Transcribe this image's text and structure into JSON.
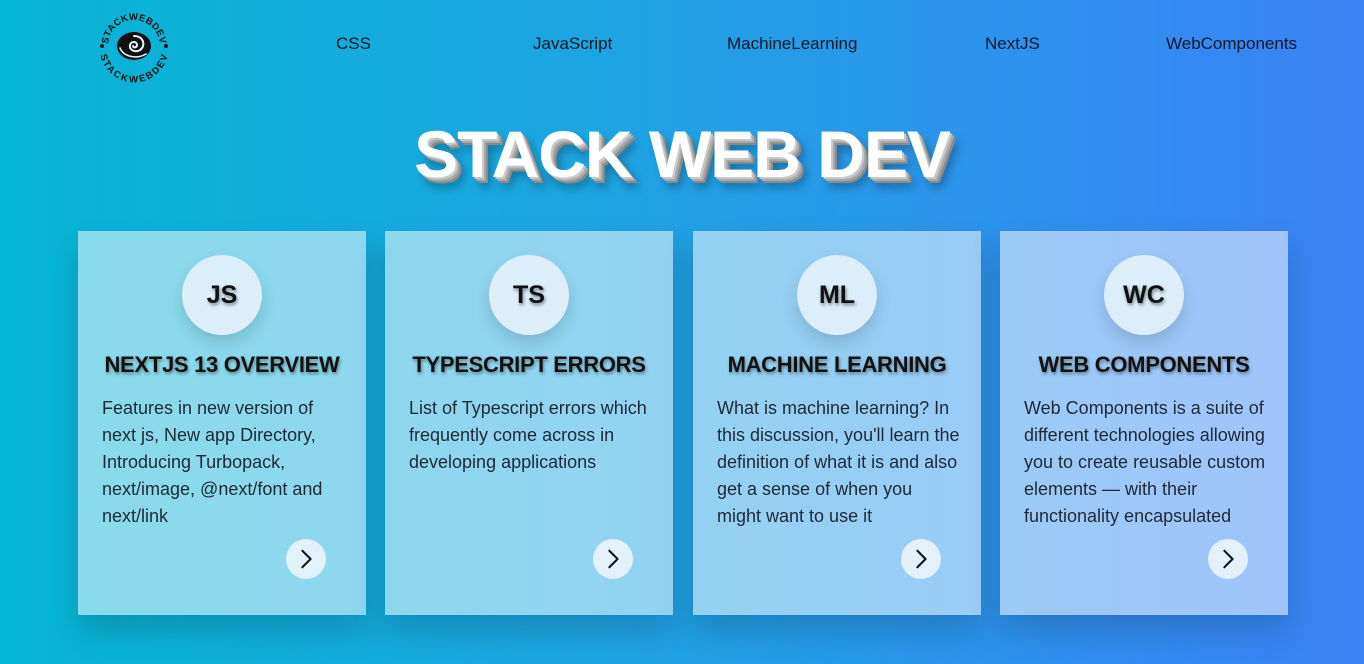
{
  "logo": {
    "text_top": "STACKWEBDEV",
    "text_bottom": "STACKWEBDEV",
    "icon": "spiral-logo-icon"
  },
  "nav": {
    "links": [
      {
        "label": "CSS"
      },
      {
        "label": "JavaScript"
      },
      {
        "label": "MachineLearning"
      },
      {
        "label": "NextJS"
      },
      {
        "label": "WebComponents"
      }
    ]
  },
  "hero": {
    "title": "STACK WEB DEV"
  },
  "cards": [
    {
      "badge": "JS",
      "title": "NEXTJS 13 OVERVIEW",
      "description": "Features in new version of next js, New app Directory, Introducing Turbopack, next/image, @next/font and next/link",
      "button_icon": "chevron-right-icon"
    },
    {
      "badge": "TS",
      "title": "TYPESCRIPT ERRORS",
      "description": "List of Typescript errors which frequently come across in developing applications",
      "button_icon": "chevron-right-icon"
    },
    {
      "badge": "ML",
      "title": "MACHINE LEARNING",
      "description": "What is machine learning? In this discussion, you'll learn the definition of what it is and also get a sense of when you might want to use it",
      "button_icon": "chevron-right-icon"
    },
    {
      "badge": "WC",
      "title": "WEB COMPONENTS",
      "description": "Web Components is a suite of different technologies allowing you to create reusable custom elements — with their functionality encapsulated",
      "button_icon": "chevron-right-icon"
    }
  ],
  "colors": {
    "bg_start": "#06b6d4",
    "bg_end": "#3b82f6",
    "card_bg": "rgba(255,255,255,0.52)",
    "text_dark": "#111111"
  }
}
